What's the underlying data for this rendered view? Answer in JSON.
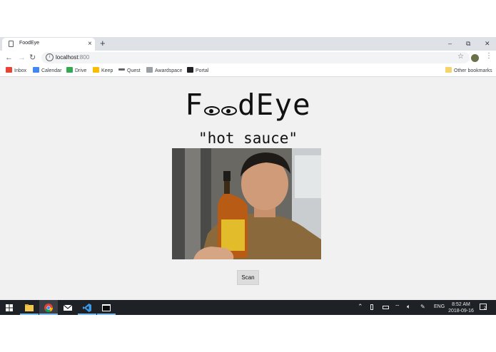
{
  "browser": {
    "tab_title": "FoodEye",
    "tab_close": "×",
    "new_tab": "+",
    "window_controls": {
      "minimize": "–",
      "restore": "⧉",
      "close": "✕"
    },
    "nav": {
      "back": "←",
      "forward": "→",
      "reload": "↻"
    },
    "url_host": "localhost",
    "url_port": ":800",
    "info": "i",
    "star": "☆",
    "menu": "⋮"
  },
  "bookmarks": [
    {
      "label": "Inbox",
      "icon": "gmail-icon",
      "color": "#ea4335"
    },
    {
      "label": "Calendar",
      "icon": "calendar-icon",
      "color": "#4285f4"
    },
    {
      "label": "Drive",
      "icon": "drive-icon",
      "color": "#34a853"
    },
    {
      "label": "Keep",
      "icon": "keep-icon",
      "color": "#fbbc04"
    },
    {
      "label": "Quest",
      "icon": "quest-icon",
      "color": "#5f6368"
    },
    {
      "label": "Awardspace",
      "icon": "awardspace-icon",
      "color": "#9aa0a6"
    },
    {
      "label": "Portal",
      "icon": "portal-icon",
      "color": "#202124"
    }
  ],
  "other_bookmarks": "Other bookmarks",
  "app": {
    "brand_prefix": "F",
    "brand_suffix": "dEye",
    "result_text": "\"hot sauce\"",
    "scan_button": "Scan"
  },
  "taskbar": {
    "language": "ENG",
    "time": "8:52 AM",
    "date": "2018-09-16",
    "notification_count": "2"
  },
  "colors": {
    "page_background": "#f1f1f1",
    "taskbar": "#1e2125",
    "taskbar_accent": "#76b9ed"
  }
}
